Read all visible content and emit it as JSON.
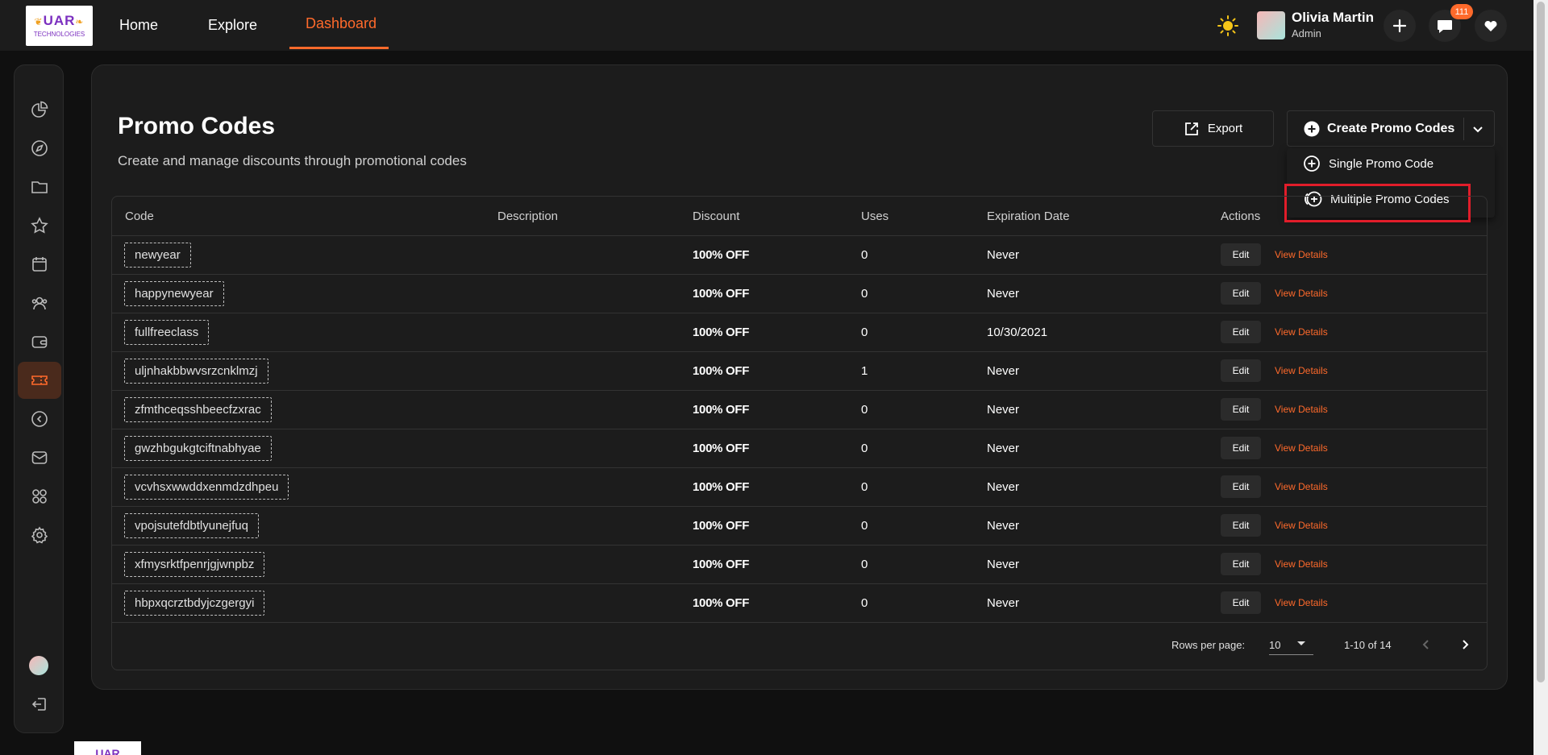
{
  "brand": {
    "line1": "UAR",
    "line2": "TECHNOLOGIES"
  },
  "nav": [
    {
      "label": "Home"
    },
    {
      "label": "Explore"
    },
    {
      "label": "Dashboard"
    }
  ],
  "user": {
    "name": "Olivia Martin",
    "role": "Admin"
  },
  "notifications": {
    "count": "111"
  },
  "page": {
    "title": "Promo Codes",
    "subtitle": "Create and manage discounts through promotional codes"
  },
  "toolbar": {
    "export_label": "Export",
    "create_label": "Create Promo Codes"
  },
  "create_menu": {
    "single_label": "Single Promo Code",
    "multiple_label": "Multiple Promo Codes"
  },
  "table": {
    "columns": [
      "Code",
      "Description",
      "Discount",
      "Uses",
      "Expiration Date",
      "Actions"
    ],
    "edit_label": "Edit",
    "view_label": "View Details",
    "rows": [
      {
        "code": "newyear",
        "description": "",
        "discount": "100% OFF",
        "uses": "0",
        "expiration": "Never"
      },
      {
        "code": "happynewyear",
        "description": "",
        "discount": "100% OFF",
        "uses": "0",
        "expiration": "Never"
      },
      {
        "code": "fullfreeclass",
        "description": "",
        "discount": "100% OFF",
        "uses": "0",
        "expiration": "10/30/2021"
      },
      {
        "code": "uljnhakbbwvsrzcnklmzj",
        "description": "",
        "discount": "100% OFF",
        "uses": "1",
        "expiration": "Never"
      },
      {
        "code": "zfmthceqsshbeecfzxrac",
        "description": "",
        "discount": "100% OFF",
        "uses": "0",
        "expiration": "Never"
      },
      {
        "code": "gwzhbgukgtciftnabhyae",
        "description": "",
        "discount": "100% OFF",
        "uses": "0",
        "expiration": "Never"
      },
      {
        "code": "vcvhsxwwddxenmdzdhpeu",
        "description": "",
        "discount": "100% OFF",
        "uses": "0",
        "expiration": "Never"
      },
      {
        "code": "vpojsutefdbtlyunejfuq",
        "description": "",
        "discount": "100% OFF",
        "uses": "0",
        "expiration": "Never"
      },
      {
        "code": "xfmysrktfpenrjgjwnpbz",
        "description": "",
        "discount": "100% OFF",
        "uses": "0",
        "expiration": "Never"
      },
      {
        "code": "hbpxqcrztbdyjczgergyi",
        "description": "",
        "discount": "100% OFF",
        "uses": "0",
        "expiration": "Never"
      }
    ]
  },
  "pagination": {
    "rows_per_page_label": "Rows per page:",
    "rows_per_page_value": "10",
    "range_label": "1-10 of 14"
  },
  "colors": {
    "accent": "#ff6a2b",
    "background": "#101010",
    "surface": "#1c1c1c",
    "highlight": "#e11d2a"
  },
  "sidebar_icons": [
    "chart-pie-icon",
    "compass-icon",
    "folder-icon",
    "star-icon",
    "calendar-icon",
    "users-icon",
    "wallet-icon",
    "ticket-icon",
    "circle-chevron-left-icon",
    "mail-icon",
    "apps-grid-icon",
    "gear-icon",
    "avatar",
    "logout-icon"
  ]
}
